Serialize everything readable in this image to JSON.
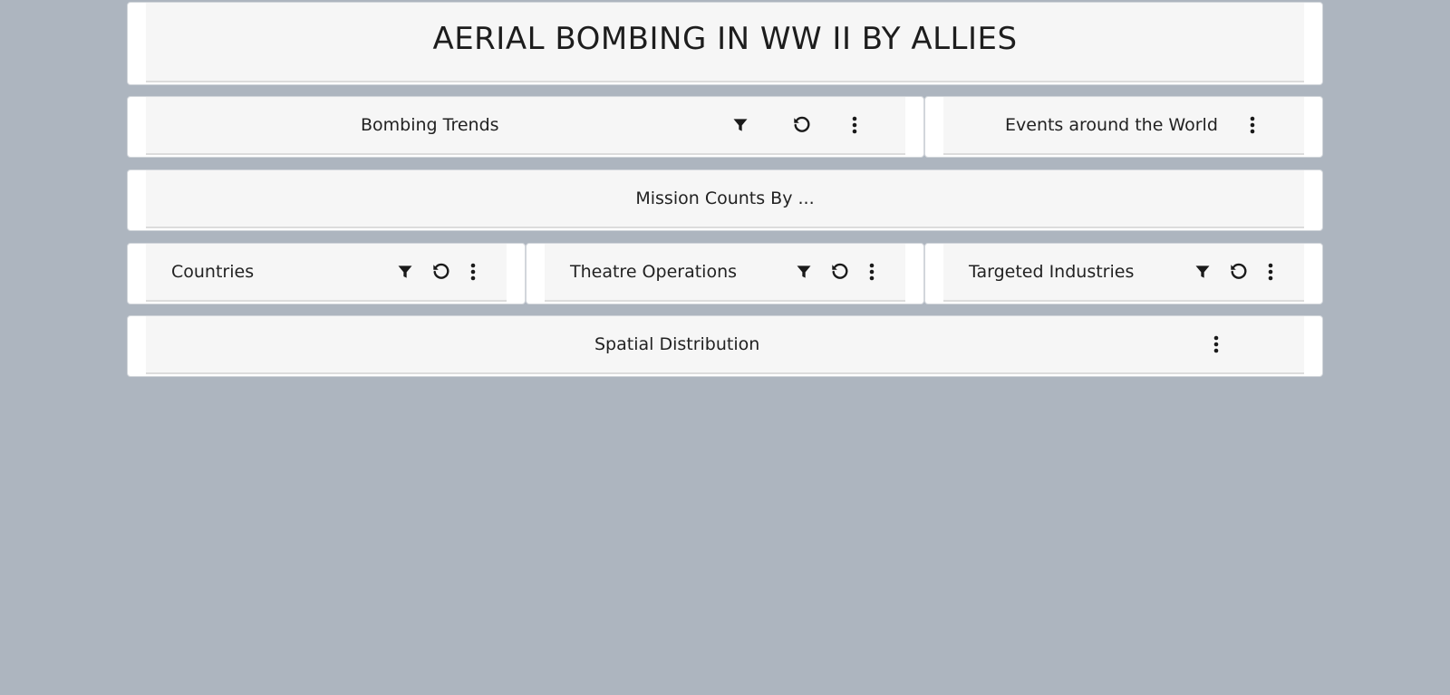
{
  "page": {
    "title": "AERIAL BOMBING IN WW II BY ALLIES",
    "background": "#adb5bf"
  },
  "cards": {
    "bombing_trends": {
      "label": "Bombing Trends",
      "icons": [
        "filter-icon",
        "reset-icon",
        "more-vert-icon"
      ]
    },
    "events_world": {
      "label": "Events around the World",
      "icons": [
        "more-vert-icon"
      ]
    },
    "mission_counts": {
      "label": "Mission Counts By ..."
    },
    "countries": {
      "label": "Countries",
      "icons": [
        "filter-icon",
        "reset-icon",
        "more-vert-icon"
      ]
    },
    "theatre_operations": {
      "label": "Theatre Operations",
      "icons": [
        "filter-icon",
        "reset-icon",
        "more-vert-icon"
      ]
    },
    "targeted_industries": {
      "label": "Targeted Industries",
      "icons": [
        "filter-icon",
        "reset-icon",
        "more-vert-icon"
      ]
    },
    "spatial_distribution": {
      "label": "Spatial Distribution",
      "icons": [
        "more-vert-icon"
      ]
    }
  },
  "colors": {
    "card_background": "#f6f6f6",
    "card_border": "#ffffff",
    "icon_color": "#1a1a1a"
  }
}
